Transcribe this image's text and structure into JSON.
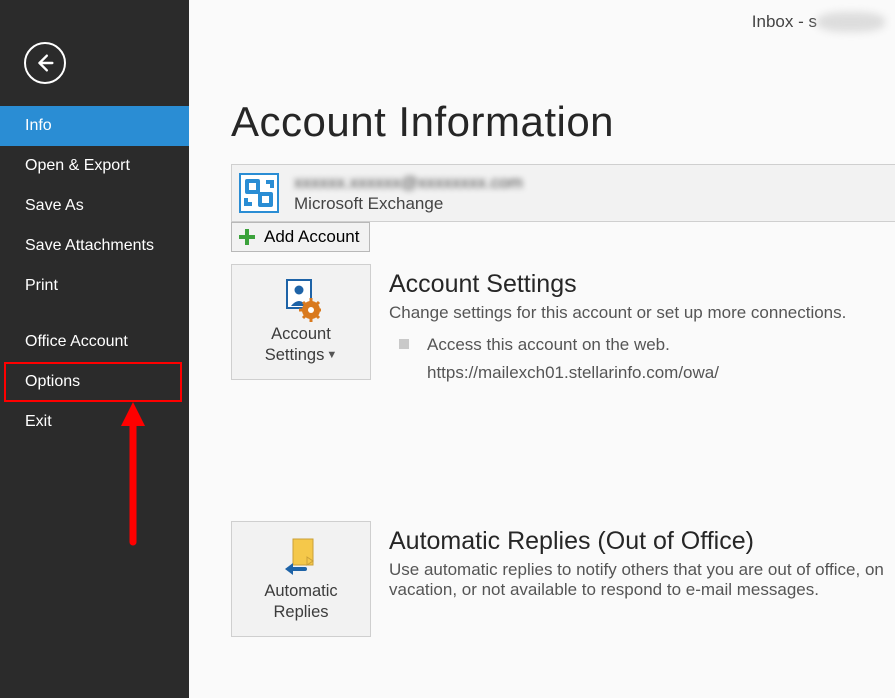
{
  "title_bar": {
    "prefix": "Inbox - s",
    "blurred_tail": "xxxxxxxx"
  },
  "sidebar": {
    "items": [
      {
        "label": "Info",
        "selected": true,
        "name": "nav-info"
      },
      {
        "label": "Open & Export",
        "selected": false,
        "name": "nav-open-export"
      },
      {
        "label": "Save As",
        "selected": false,
        "name": "nav-save-as"
      },
      {
        "label": "Save Attachments",
        "selected": false,
        "name": "nav-save-attachments"
      },
      {
        "label": "Print",
        "selected": false,
        "name": "nav-print"
      }
    ],
    "lower_items": [
      {
        "label": "Office Account",
        "name": "nav-office-account"
      },
      {
        "label": "Options",
        "name": "nav-options"
      },
      {
        "label": "Exit",
        "name": "nav-exit"
      }
    ]
  },
  "main": {
    "page_title": "Account Information",
    "account": {
      "email_suffix": ".com",
      "type": "Microsoft Exchange"
    },
    "add_account_label": "Add Account",
    "account_settings": {
      "tile_label_line1": "Account",
      "tile_label_line2": "Settings",
      "title": "Account Settings",
      "desc": "Change settings for this account or set up more connections.",
      "bullet_line1": "Access this account on the web.",
      "bullet_line2": "https://mailexch01.stellarinfo.com/owa/"
    },
    "auto_replies": {
      "tile_label_line1": "Automatic",
      "tile_label_line2": "Replies",
      "title": "Automatic Replies (Out of Office)",
      "desc": "Use automatic replies to notify others that you are out of office, on vacation, or not available to respond to e-mail messages."
    }
  }
}
